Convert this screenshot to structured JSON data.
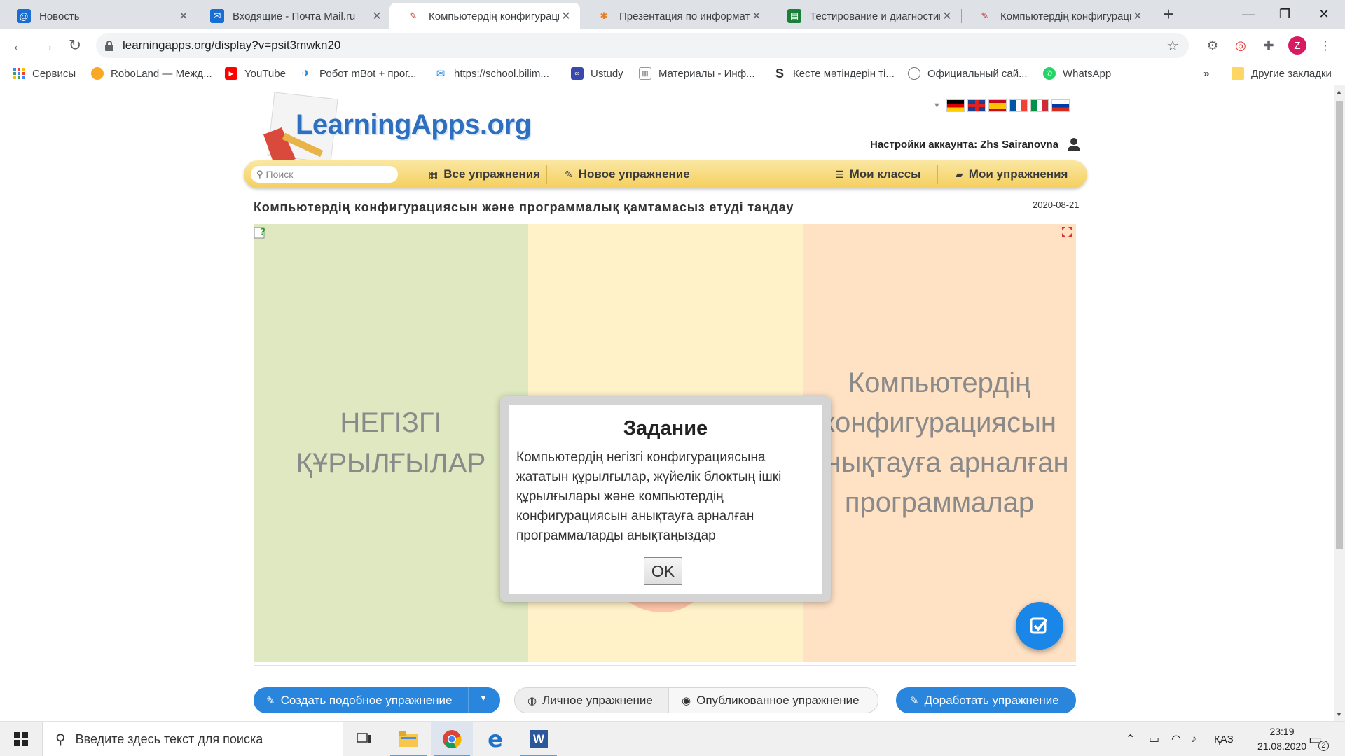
{
  "browser": {
    "tabs": [
      {
        "title": "Новость",
        "icon": "mail-ru-icon",
        "color": "#1a6dd1"
      },
      {
        "title": "Входящие - Почта Mail.ru",
        "icon": "mail-envelope-icon",
        "color": "#1a6dd1"
      },
      {
        "title": "Компьютердің конфигурацио",
        "icon": "learningapps-icon",
        "color": "#c0392b",
        "active": true
      },
      {
        "title": "Презентация по информатике",
        "icon": "pinwheel-icon",
        "color": "#e67e22"
      },
      {
        "title": "Тестирование и диагностика",
        "icon": "sheets-icon",
        "color": "#188038"
      },
      {
        "title": "Компьютердің конфигурацио",
        "icon": "learningapps-icon",
        "color": "#c0392b"
      }
    ],
    "address": "learningapps.org/display?v=psit3mwkn20",
    "profile_initial": "Z",
    "bookmarks": [
      {
        "label": "Сервисы",
        "icon": "apps-grid-icon"
      },
      {
        "label": "RoboLand — Межд...",
        "icon": "roboland-icon"
      },
      {
        "label": "YouTube",
        "icon": "youtube-icon"
      },
      {
        "label": "Робот mBot + прог...",
        "icon": "bird-icon"
      },
      {
        "label": "https://school.bilim...",
        "icon": "school-icon"
      },
      {
        "label": "Ustudy",
        "icon": "ustudy-icon"
      },
      {
        "label": "Материалы - Инф...",
        "icon": "doc-icon"
      },
      {
        "label": "Кесте мәтіндерін ті...",
        "icon": "s-icon"
      },
      {
        "label": "Официальный сай...",
        "icon": "globe-icon"
      },
      {
        "label": "WhatsApp",
        "icon": "whatsapp-icon"
      }
    ],
    "more_bookmarks": "»",
    "other_bookmarks": "Другие закладки"
  },
  "site": {
    "logo": "LearningApps.org",
    "account_label": "Настройки аккаунта: Zhs Sairanovna",
    "search_placeholder": "Поиск",
    "nav": {
      "all": "Все упражнения",
      "new": "Новое упражнение",
      "classes": "Мои классы",
      "mine": "Мои упражнения"
    },
    "exercise_title": "Компьютердің конфигурациясын және программалық қамтамасыз етуді таңдау",
    "date": "2020-08-21",
    "columns": [
      {
        "label": "НЕГІЗГІ ҚҰРЫЛҒЫЛАР",
        "color": "#dfe8c0"
      },
      {
        "label": "",
        "color": "#fff1c8"
      },
      {
        "label": "Компьютердің конфигурациясын анықтауға арналған программалар",
        "color": "#ffe1c4"
      }
    ],
    "dialog": {
      "title": "Задание",
      "text": "Компьютердің негізгі конфигурациясына жататын құрылғылар, жүйелік блоктың ішкі құрылғылары және компьютердің конфигурациясын анықтауға арналған программаларды анықтаңыздар",
      "ok": "OK"
    },
    "buttons": {
      "create_similar": "Создать подобное упражнение",
      "private": "Личное упражнение",
      "published": "Опубликованное упражнение",
      "edit": "Доработать упражнение"
    }
  },
  "taskbar": {
    "search_placeholder": "Введите здесь текст для поиска",
    "language": "ҚАЗ",
    "time": "23:19",
    "date": "21.08.2020",
    "notifications": "2"
  }
}
